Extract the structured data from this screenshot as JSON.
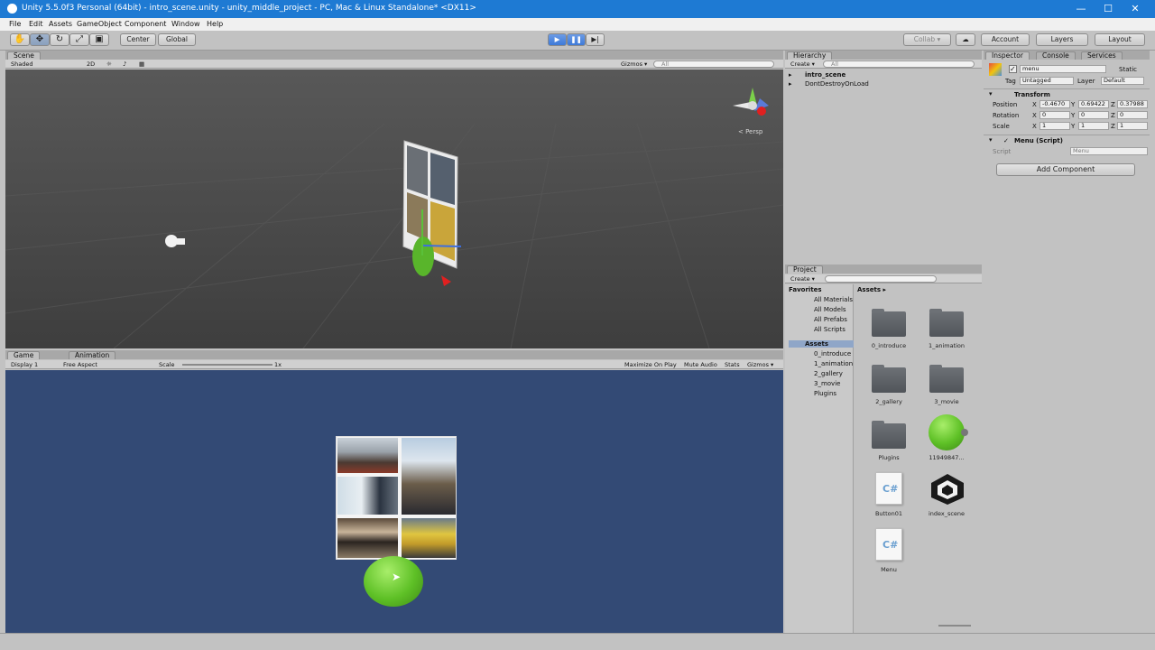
{
  "window": {
    "title": "Unity 5.5.0f3 Personal (64bit) - intro_scene.unity - unity_middle_project - PC, Mac & Linux Standalone* <DX11>",
    "minimize": "—",
    "maximize": "☐",
    "close": "✕"
  },
  "menu": [
    "File",
    "Edit",
    "Assets",
    "GameObject",
    "Component",
    "Window",
    "Help"
  ],
  "toolbar": {
    "tools": [
      "hand-tool-icon",
      "move-tool-icon",
      "rotate-tool-icon",
      "scale-tool-icon",
      "rect-tool-icon"
    ],
    "pivot": "Center",
    "space": "Global",
    "collab": "Collab ▾",
    "account": "Account",
    "layers": "Layers",
    "layout": "Layout"
  },
  "scene": {
    "tab": "Scene",
    "shading": "Shaded",
    "mode2d": "2D",
    "gizmos": "Gizmos ▾",
    "search": "All",
    "persp": "< Persp"
  },
  "game": {
    "tabs": [
      "Game",
      "Animation"
    ],
    "display": "Display 1",
    "aspect": "Free Aspect",
    "scale_label": "Scale",
    "scale_value": "1x",
    "maximize": "Maximize On Play",
    "mute": "Mute Audio",
    "stats": "Stats",
    "gizmos": "Gizmos ▾",
    "background": "#334a75"
  },
  "hierarchy": {
    "tab": "Hierarchy",
    "create": "Create ▾",
    "search": "All",
    "items": [
      "intro_scene",
      "DontDestroyOnLoad"
    ]
  },
  "project": {
    "tab": "Project",
    "create": "Create ▾",
    "favorites_label": "Favorites",
    "favorites": [
      "All Materials",
      "All Models",
      "All Prefabs",
      "All Scripts"
    ],
    "assets_label": "Assets",
    "tree": [
      "0_introduce",
      "1_animation",
      "2_gallery",
      "3_movie",
      "Plugins"
    ],
    "breadcrumb": "Assets ▸",
    "grid": [
      {
        "name": "0_introduce",
        "kind": "folder"
      },
      {
        "name": "1_animation",
        "kind": "folder"
      },
      {
        "name": "2_gallery",
        "kind": "folder"
      },
      {
        "name": "3_movie",
        "kind": "folder"
      },
      {
        "name": "Plugins",
        "kind": "folder"
      },
      {
        "name": "11949847...",
        "kind": "sprite"
      },
      {
        "name": "Button01",
        "kind": "script"
      },
      {
        "name": "index_scene",
        "kind": "scene"
      },
      {
        "name": "Menu",
        "kind": "script"
      }
    ]
  },
  "inspector": {
    "tabs": [
      "Inspector",
      "Console",
      "Services"
    ],
    "object_name": "menu",
    "static": "Static",
    "tag_label": "Tag",
    "tag": "Untagged",
    "layer_label": "Layer",
    "layer": "Default",
    "transform": {
      "header": "Transform",
      "position_label": "Position",
      "rotation_label": "Rotation",
      "scale_label": "Scale",
      "position": {
        "x": "-0.4670",
        "y": "0.69422",
        "z": "0.37988"
      },
      "rotation": {
        "x": "0",
        "y": "0",
        "z": "0"
      },
      "scale": {
        "x": "1",
        "y": "1",
        "z": "1"
      }
    },
    "script": {
      "header": "Menu (Script)",
      "label": "Script",
      "value": "Menu"
    },
    "add_component": "Add Component"
  },
  "colors": {
    "title_bar": "#1e7ad3",
    "scene_bg": "#4a4a4a",
    "game_bg": "#334a75",
    "panel": "#c2c2c2",
    "play_active": "#3e7ad8",
    "sprite_green": "#5ec026"
  }
}
